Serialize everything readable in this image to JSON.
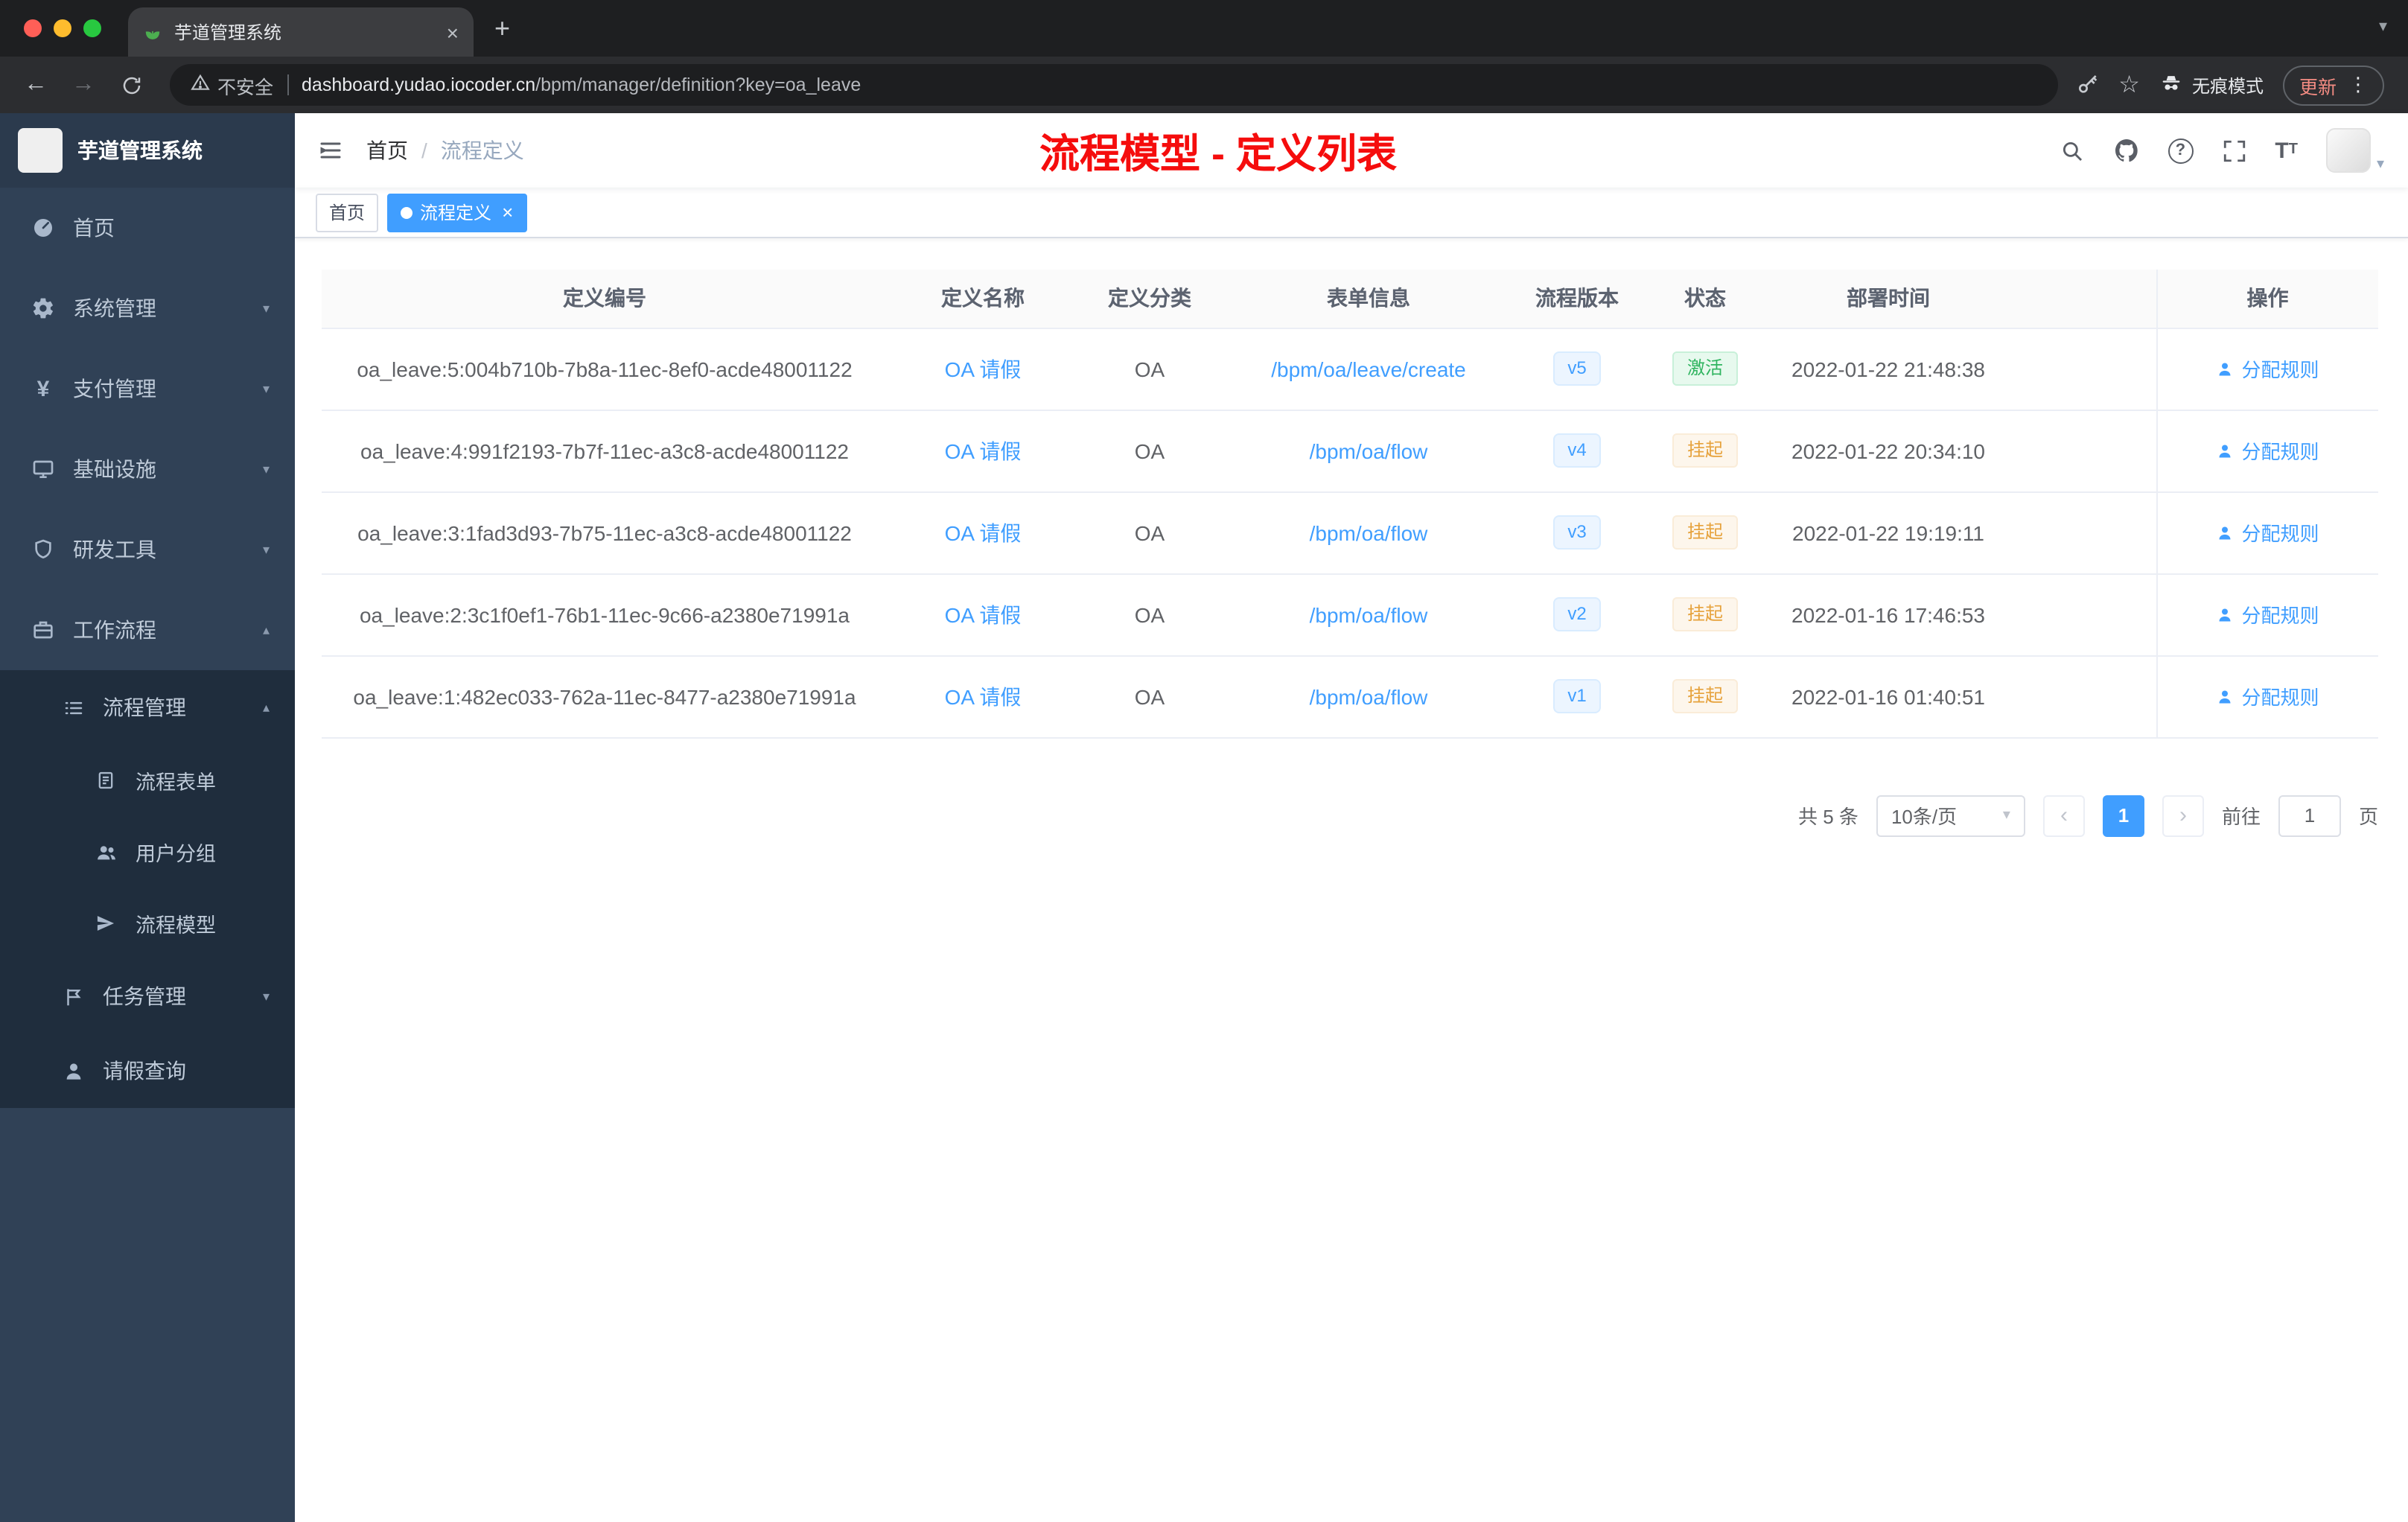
{
  "browser": {
    "tab_title": "芋道管理系统",
    "security_label": "不安全",
    "url_domain": "dashboard.yudao.iocoder.cn",
    "url_path": "/bpm/manager/definition?key=oa_leave",
    "incognito_label": "无痕模式",
    "update_label": "更新"
  },
  "icons": {
    "close": "×",
    "plus": "+",
    "more": "⋮",
    "caret_down": "▾",
    "caret_up": "▴",
    "star": "☆",
    "help": "?",
    "back": "←",
    "forward": "→",
    "page_prev": "‹",
    "page_next": "›",
    "yen": "¥",
    "big_t": "T",
    "small_t": "T"
  },
  "sidebar": {
    "logo_title": "芋道管理系统",
    "menu": {
      "home": "首页",
      "system": "系统管理",
      "payment": "支付管理",
      "infra": "基础设施",
      "dev_tools": "研发工具",
      "workflow": "工作流程",
      "process_mgmt": "流程管理",
      "process_form": "流程表单",
      "user_group": "用户分组",
      "process_model": "流程模型",
      "task_mgmt": "任务管理",
      "leave_query": "请假查询"
    }
  },
  "header": {
    "breadcrumb_home": "首页",
    "breadcrumb_current": "流程定义",
    "annotation_title": "流程模型 - 定义列表"
  },
  "tags_view": {
    "home_tag": "首页",
    "active_tag": "流程定义"
  },
  "table": {
    "columns": [
      "定义编号",
      "定义名称",
      "定义分类",
      "表单信息",
      "流程版本",
      "状态",
      "部署时间",
      "操作"
    ],
    "action_label": "分配规则",
    "rows": [
      {
        "id": "oa_leave:5:004b710b-7b8a-11ec-8ef0-acde48001122",
        "name": "OA 请假",
        "category": "OA",
        "form": "/bpm/oa/leave/create",
        "version": "v5",
        "status": "激活",
        "status_type": "success",
        "time": "2022-01-22 21:48:38"
      },
      {
        "id": "oa_leave:4:991f2193-7b7f-11ec-a3c8-acde48001122",
        "name": "OA 请假",
        "category": "OA",
        "form": "/bpm/oa/flow",
        "version": "v4",
        "status": "挂起",
        "status_type": "warning",
        "time": "2022-01-22 20:34:10"
      },
      {
        "id": "oa_leave:3:1fad3d93-7b75-11ec-a3c8-acde48001122",
        "name": "OA 请假",
        "category": "OA",
        "form": "/bpm/oa/flow",
        "version": "v3",
        "status": "挂起",
        "status_type": "warning",
        "time": "2022-01-22 19:19:11"
      },
      {
        "id": "oa_leave:2:3c1f0ef1-76b1-11ec-9c66-a2380e71991a",
        "name": "OA 请假",
        "category": "OA",
        "form": "/bpm/oa/flow",
        "version": "v2",
        "status": "挂起",
        "status_type": "warning",
        "time": "2022-01-16 17:46:53"
      },
      {
        "id": "oa_leave:1:482ec033-762a-11ec-8477-a2380e71991a",
        "name": "OA 请假",
        "category": "OA",
        "form": "/bpm/oa/flow",
        "version": "v1",
        "status": "挂起",
        "status_type": "warning",
        "time": "2022-01-16 01:40:51"
      }
    ]
  },
  "pagination": {
    "total": "共 5 条",
    "page_size": "10条/页",
    "current_page": "1",
    "goto_label": "前往",
    "goto_value": "1",
    "goto_unit": "页"
  },
  "colors": {
    "accent": "#409eff",
    "success": "#2fb45f",
    "warning": "#e6a23c",
    "annotation_red": "#f50d0d",
    "sidebar_bg": "#304156",
    "submenu_bg": "#1f2d3d"
  }
}
